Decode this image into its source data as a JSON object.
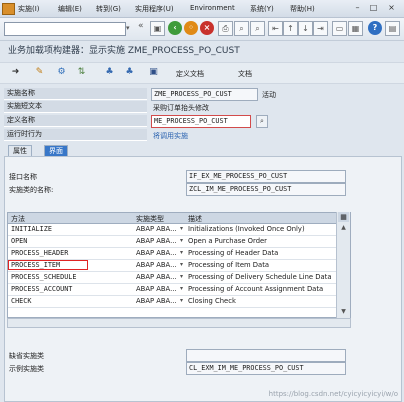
{
  "menubar": {
    "items": [
      "实施(I)",
      "编辑(E)",
      "转到(G)",
      "实用程序(U)",
      "Environment",
      "系统(Y)",
      "帮助(H)"
    ]
  },
  "toolbar": {
    "command_value": ""
  },
  "page": {
    "title": "业务加载项构建器：显示实施 ZME_PROCESS_PO_CUST"
  },
  "app_toolbar": {
    "def_doc": "定义文档",
    "doc": "文档"
  },
  "header": {
    "impl_name_label": "实施名称",
    "impl_name_value": "ZME_PROCESS_PO_CUST",
    "impl_status": "活动",
    "impl_short_text_label": "实施短文本",
    "impl_short_text_value": "采购订单抬头修改",
    "def_name_label": "定义名称",
    "def_name_value": "ME_PROCESS_PO_CUST",
    "runtime_label": "运行时行为",
    "runtime_value": "将调用实施"
  },
  "tabs": [
    {
      "label": "属性",
      "active": false
    },
    {
      "label": "界面",
      "active": true
    }
  ],
  "interface": {
    "iface_label": "接口名称",
    "iface_value": "IF_EX_ME_PROCESS_PO_CUST",
    "class_label": "实施类的名称:",
    "class_value": "ZCL_IM_ME_PROCESS_PO_CUST"
  },
  "methods_table": {
    "columns": [
      "方法",
      "实施类型",
      "描述"
    ],
    "rows": [
      {
        "method": "INITIALIZE",
        "type": "ABAP ABA...",
        "desc": "Initializations (Invoked Once Only)"
      },
      {
        "method": "OPEN",
        "type": "ABAP ABA...",
        "desc": "Open a Purchase Order"
      },
      {
        "method": "PROCESS_HEADER",
        "type": "ABAP ABA...",
        "desc": "Processing of Header Data"
      },
      {
        "method": "PROCESS_ITEM",
        "type": "ABAP ABA...",
        "desc": "Processing of Item Data"
      },
      {
        "method": "PROCESS_SCHEDULE",
        "type": "ABAP ABA...",
        "desc": "Processing of Delivery Schedule Line Data"
      },
      {
        "method": "PROCESS_ACCOUNT",
        "type": "ABAP ABA...",
        "desc": "Processing of Account Assignment Data"
      },
      {
        "method": "CHECK",
        "type": "ABAP ABA...",
        "desc": "Closing Check"
      }
    ]
  },
  "footer": {
    "missing_label": "缺省实施类",
    "sample_label": "示例实施类",
    "sample_value": "CL_EXM_IM_ME_PROCESS_PO_CUST"
  },
  "watermark": "https://blog.csdn.net/cyicyicyicyi/w/o"
}
